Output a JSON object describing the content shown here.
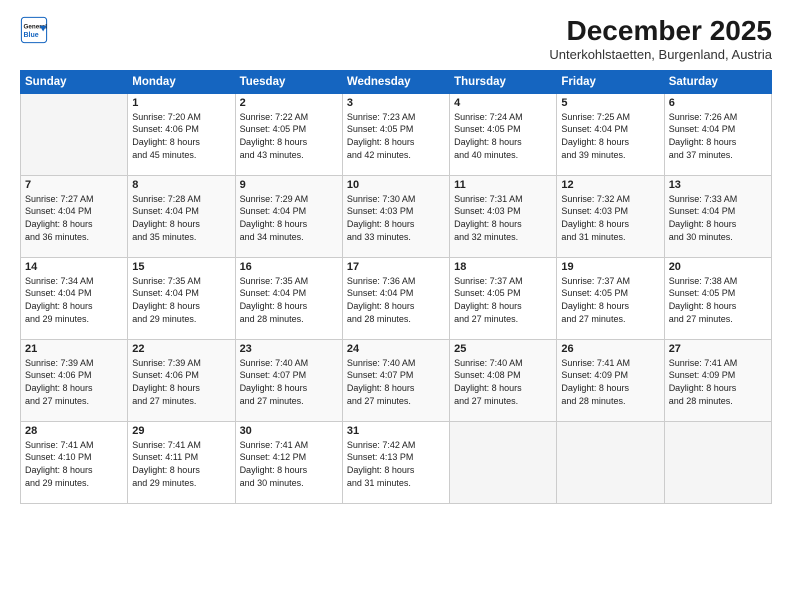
{
  "header": {
    "logo_line1": "General",
    "logo_line2": "Blue",
    "month": "December 2025",
    "location": "Unterkohlstaetten, Burgenland, Austria"
  },
  "weekdays": [
    "Sunday",
    "Monday",
    "Tuesday",
    "Wednesday",
    "Thursday",
    "Friday",
    "Saturday"
  ],
  "weeks": [
    [
      {
        "day": "",
        "info": ""
      },
      {
        "day": "1",
        "info": "Sunrise: 7:20 AM\nSunset: 4:06 PM\nDaylight: 8 hours\nand 45 minutes."
      },
      {
        "day": "2",
        "info": "Sunrise: 7:22 AM\nSunset: 4:05 PM\nDaylight: 8 hours\nand 43 minutes."
      },
      {
        "day": "3",
        "info": "Sunrise: 7:23 AM\nSunset: 4:05 PM\nDaylight: 8 hours\nand 42 minutes."
      },
      {
        "day": "4",
        "info": "Sunrise: 7:24 AM\nSunset: 4:05 PM\nDaylight: 8 hours\nand 40 minutes."
      },
      {
        "day": "5",
        "info": "Sunrise: 7:25 AM\nSunset: 4:04 PM\nDaylight: 8 hours\nand 39 minutes."
      },
      {
        "day": "6",
        "info": "Sunrise: 7:26 AM\nSunset: 4:04 PM\nDaylight: 8 hours\nand 37 minutes."
      }
    ],
    [
      {
        "day": "7",
        "info": "Sunrise: 7:27 AM\nSunset: 4:04 PM\nDaylight: 8 hours\nand 36 minutes."
      },
      {
        "day": "8",
        "info": "Sunrise: 7:28 AM\nSunset: 4:04 PM\nDaylight: 8 hours\nand 35 minutes."
      },
      {
        "day": "9",
        "info": "Sunrise: 7:29 AM\nSunset: 4:04 PM\nDaylight: 8 hours\nand 34 minutes."
      },
      {
        "day": "10",
        "info": "Sunrise: 7:30 AM\nSunset: 4:03 PM\nDaylight: 8 hours\nand 33 minutes."
      },
      {
        "day": "11",
        "info": "Sunrise: 7:31 AM\nSunset: 4:03 PM\nDaylight: 8 hours\nand 32 minutes."
      },
      {
        "day": "12",
        "info": "Sunrise: 7:32 AM\nSunset: 4:03 PM\nDaylight: 8 hours\nand 31 minutes."
      },
      {
        "day": "13",
        "info": "Sunrise: 7:33 AM\nSunset: 4:04 PM\nDaylight: 8 hours\nand 30 minutes."
      }
    ],
    [
      {
        "day": "14",
        "info": "Sunrise: 7:34 AM\nSunset: 4:04 PM\nDaylight: 8 hours\nand 29 minutes."
      },
      {
        "day": "15",
        "info": "Sunrise: 7:35 AM\nSunset: 4:04 PM\nDaylight: 8 hours\nand 29 minutes."
      },
      {
        "day": "16",
        "info": "Sunrise: 7:35 AM\nSunset: 4:04 PM\nDaylight: 8 hours\nand 28 minutes."
      },
      {
        "day": "17",
        "info": "Sunrise: 7:36 AM\nSunset: 4:04 PM\nDaylight: 8 hours\nand 28 minutes."
      },
      {
        "day": "18",
        "info": "Sunrise: 7:37 AM\nSunset: 4:05 PM\nDaylight: 8 hours\nand 27 minutes."
      },
      {
        "day": "19",
        "info": "Sunrise: 7:37 AM\nSunset: 4:05 PM\nDaylight: 8 hours\nand 27 minutes."
      },
      {
        "day": "20",
        "info": "Sunrise: 7:38 AM\nSunset: 4:05 PM\nDaylight: 8 hours\nand 27 minutes."
      }
    ],
    [
      {
        "day": "21",
        "info": "Sunrise: 7:39 AM\nSunset: 4:06 PM\nDaylight: 8 hours\nand 27 minutes."
      },
      {
        "day": "22",
        "info": "Sunrise: 7:39 AM\nSunset: 4:06 PM\nDaylight: 8 hours\nand 27 minutes."
      },
      {
        "day": "23",
        "info": "Sunrise: 7:40 AM\nSunset: 4:07 PM\nDaylight: 8 hours\nand 27 minutes."
      },
      {
        "day": "24",
        "info": "Sunrise: 7:40 AM\nSunset: 4:07 PM\nDaylight: 8 hours\nand 27 minutes."
      },
      {
        "day": "25",
        "info": "Sunrise: 7:40 AM\nSunset: 4:08 PM\nDaylight: 8 hours\nand 27 minutes."
      },
      {
        "day": "26",
        "info": "Sunrise: 7:41 AM\nSunset: 4:09 PM\nDaylight: 8 hours\nand 28 minutes."
      },
      {
        "day": "27",
        "info": "Sunrise: 7:41 AM\nSunset: 4:09 PM\nDaylight: 8 hours\nand 28 minutes."
      }
    ],
    [
      {
        "day": "28",
        "info": "Sunrise: 7:41 AM\nSunset: 4:10 PM\nDaylight: 8 hours\nand 29 minutes."
      },
      {
        "day": "29",
        "info": "Sunrise: 7:41 AM\nSunset: 4:11 PM\nDaylight: 8 hours\nand 29 minutes."
      },
      {
        "day": "30",
        "info": "Sunrise: 7:41 AM\nSunset: 4:12 PM\nDaylight: 8 hours\nand 30 minutes."
      },
      {
        "day": "31",
        "info": "Sunrise: 7:42 AM\nSunset: 4:13 PM\nDaylight: 8 hours\nand 31 minutes."
      },
      {
        "day": "",
        "info": ""
      },
      {
        "day": "",
        "info": ""
      },
      {
        "day": "",
        "info": ""
      }
    ]
  ]
}
